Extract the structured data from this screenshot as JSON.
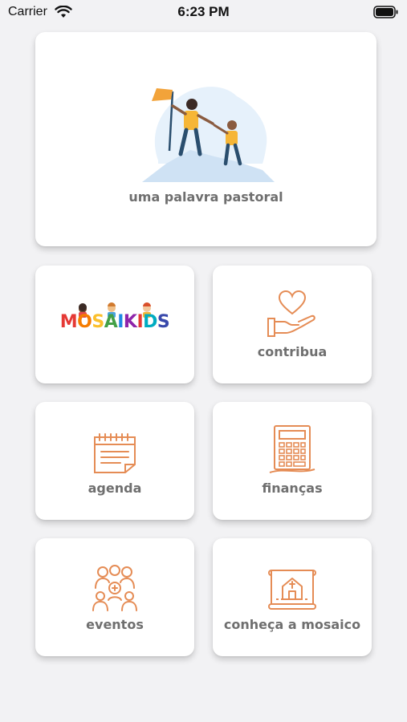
{
  "status_bar": {
    "carrier": "Carrier",
    "time": "6:23 PM",
    "icons": [
      "wifi-icon",
      "battery-icon"
    ]
  },
  "menu": {
    "pastoral": {
      "label": "uma palavra pastoral",
      "icon": "flag-climb-illustration"
    },
    "mosaikids": {
      "logo": "MOSAIKIDS",
      "icon": "kids-logo"
    },
    "contribua": {
      "label": "contribua",
      "icon": "heart-hand-icon"
    },
    "agenda": {
      "label": "agenda",
      "icon": "calendar-icon"
    },
    "financas": {
      "label": "finanças",
      "icon": "calculator-icon"
    },
    "eventos": {
      "label": "eventos",
      "icon": "people-group-icon"
    },
    "conheca": {
      "label": "conheça a mosaico",
      "icon": "church-map-icon"
    }
  },
  "colors": {
    "icon_orange": "#e58c55",
    "label_gray": "#6f6f6f",
    "background": "#f2f2f4"
  }
}
